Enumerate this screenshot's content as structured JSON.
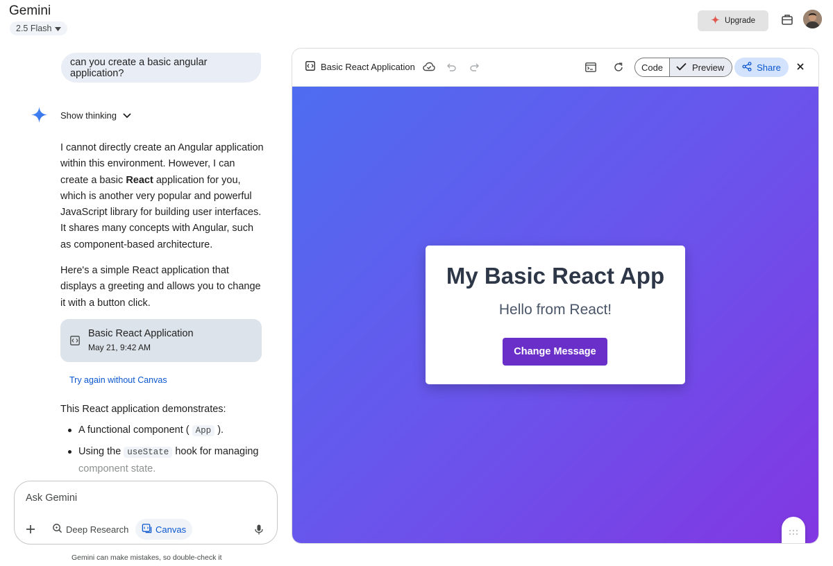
{
  "header": {
    "app_title": "Gemini",
    "model": "2.5 Flash",
    "upgrade_label": "Upgrade"
  },
  "chat": {
    "user_message": "can you create a basic angular application?",
    "show_thinking": "Show thinking",
    "para1_a": "I cannot directly create an Angular application within this environment. However, I can create a basic ",
    "para1_bold": "React",
    "para1_b": " application for you, which is another very popular and powerful JavaScript library for building user interfaces. It shares many concepts with Angular, such as component-based architecture.",
    "para2": "Here's a simple React application that displays a greeting and allows you to change it with a button click.",
    "card_title": "Basic React Application",
    "card_date": "May 21, 9:42 AM",
    "try_again": "Try again without Canvas",
    "para3": "This React application demonstrates:",
    "bullet1_a": "A functional component (",
    "bullet1_code": "App",
    "bullet1_b": ").",
    "bullet2_a": "Using the ",
    "bullet2_code": "useState",
    "bullet2_b": " hook for managing",
    "bullet2_faded": "component state."
  },
  "input": {
    "placeholder": "Ask Gemini",
    "deep_research": "Deep Research",
    "canvas": "Canvas",
    "disclaimer": "Gemini can make mistakes, so double-check it"
  },
  "panel": {
    "title": "Basic React Application",
    "code_tab": "Code",
    "preview_tab": "Preview",
    "share_label": "Share"
  },
  "preview": {
    "heading": "My Basic React App",
    "message": "Hello from React!",
    "button_label": "Change Message"
  },
  "colors": {
    "accent": "#0b57d0",
    "gradient_start": "#4e6df0",
    "gradient_end": "#8237e2",
    "demo_button": "#6b2fc9"
  }
}
